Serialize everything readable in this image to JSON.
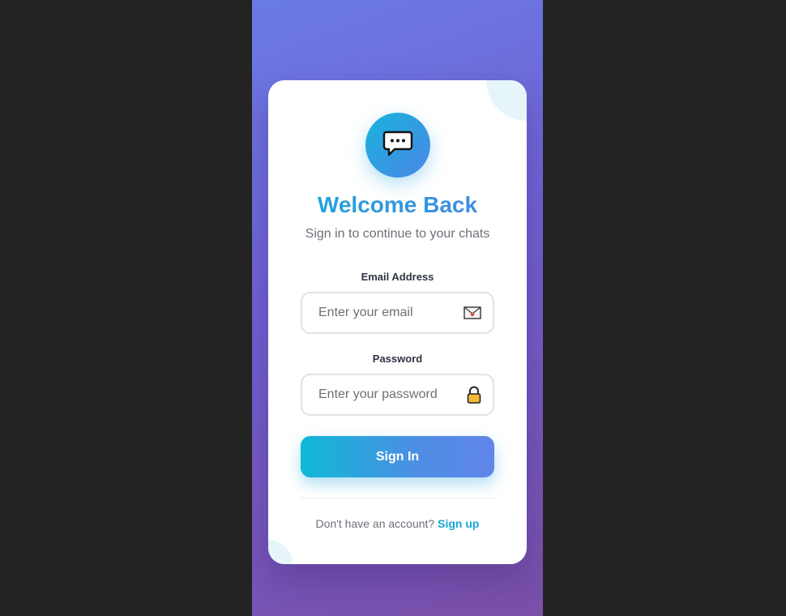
{
  "login": {
    "title": "Welcome Back",
    "subtitle": "Sign in to continue to your chats",
    "email": {
      "label": "Email Address",
      "placeholder": "Enter your email",
      "value": "",
      "icon": "envelope-icon"
    },
    "password": {
      "label": "Password",
      "placeholder": "Enter your password",
      "value": "",
      "icon": "lock-icon"
    },
    "submit_label": "Sign In",
    "footer_text": "Don't have an account?",
    "signup_label": "Sign up",
    "logo_icon": "chat-bubble-icon"
  },
  "colors": {
    "accent_start": "#0fb8d6",
    "accent_end": "#6186ea",
    "background_start": "#6a7be6",
    "background_end": "#7a4fa8"
  }
}
